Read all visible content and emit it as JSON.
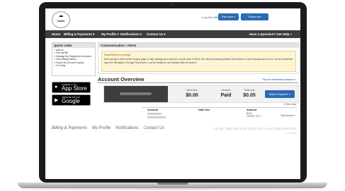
{
  "header": {
    "logo_text": "Cable",
    "top_links": "Log Out  |  MMIS  |  Help  |  Large Network",
    "pay_button": "Pay Now »",
    "outage_button": "Report An Issue/Inquiry"
  },
  "nav": {
    "items": [
      "Home",
      "Billing & Payments ▾",
      "My Profile ▾",
      "Notifications ▾",
      "Contact Us ▾"
    ],
    "help": "Have a Question? Get Help »"
  },
  "sidebar": {
    "title": "Quick Links",
    "intro": "I want to...",
    "links": [
      "Pay My Bill",
      "Manage My Registered Accounts",
      "View Billing History",
      "Report An Account Inquiry",
      "Go Daily"
    ]
  },
  "app_store": {
    "small": "Available on the",
    "big": "App Store"
  },
  "google_play": {
    "small": "ANDROID APP ON",
    "big": "Google play"
  },
  "communication": {
    "title": "Communication / Alerts",
    "headline": "SmartHub is coming!",
    "message": "We're going to add a better looking page to help manage your account. Launch date: 2/18/22. We will be providing detailed information on how to download our free, secure SmartHub app from the Apple & Google Play stores. Look for details on our website after the launch."
  },
  "account_overview": {
    "title": "Account Overview",
    "link": "Pay all outstanding balances »",
    "last_bill_label": "Next Due",
    "last_bill_value": "$0.00",
    "amount_label": "Amount",
    "amount_value": "Paid",
    "total_label": "Total Due",
    "total_value": "$0.05",
    "make_payment": "Make Payment »",
    "see_less": "▾ See Less"
  },
  "table": {
    "headers": [
      "Account",
      "Date Due",
      "Amount"
    ],
    "amount_line1": "$0.00",
    "amount_line2": "CREDIT OUT +",
    "pay_link": "Pay Account »"
  },
  "footer": {
    "links": [
      "Billing & Payments",
      "My Profile",
      "Notifications",
      "Contact Us"
    ],
    "call": "Call Us: (888) 555-1234 (Toll-Free) | Local: (555) 555-0100",
    "powered": "Powered By"
  }
}
